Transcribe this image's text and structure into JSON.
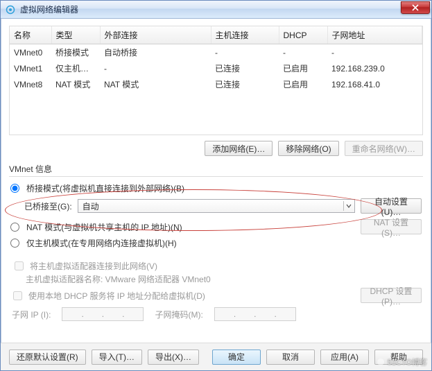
{
  "window": {
    "title": "虚拟网络编辑器",
    "close_icon": "close-icon"
  },
  "table": {
    "headers": {
      "name": "名称",
      "type": "类型",
      "external": "外部连接",
      "host": "主机连接",
      "dhcp": "DHCP",
      "subnet": "子网地址"
    },
    "rows": [
      {
        "name": "VMnet0",
        "type": "桥接模式",
        "external": "自动桥接",
        "host": "-",
        "dhcp": "-",
        "subnet": "-"
      },
      {
        "name": "VMnet1",
        "type": "仅主机…",
        "external": "-",
        "host": "已连接",
        "dhcp": "已启用",
        "subnet": "192.168.239.0"
      },
      {
        "name": "VMnet8",
        "type": "NAT 模式",
        "external": "NAT 模式",
        "host": "已连接",
        "dhcp": "已启用",
        "subnet": "192.168.41.0"
      }
    ]
  },
  "buttons": {
    "add_net": "添加网络(E)…",
    "remove_net": "移除网络(O)",
    "rename_net": "重命名网络(W)…",
    "auto_set": "自动设置(U)…",
    "nat_set": "NAT 设置(S)…",
    "dhcp_set": "DHCP 设置(P)…",
    "restore": "还原默认设置(R)",
    "import": "导入(T)…",
    "export": "导出(X)…",
    "ok": "确定",
    "cancel": "取消",
    "apply": "应用(A)",
    "help": "帮助"
  },
  "info": {
    "section_title": "VMnet 信息",
    "bridge_label": "桥接模式(将虚拟机直接连接到外部网络)(B)",
    "bridge_to_label": "已桥接至(G):",
    "bridge_to_value": "自动",
    "nat_label": "NAT 模式(与虚拟机共享主机的 IP 地址)(N)",
    "hostonly_label": "仅主机模式(在专用网络内连接虚拟机)(H)",
    "connect_host_label": "将主机虚拟适配器连接到此网络(V)",
    "adapter_name_label": "主机虚拟适配器名称: VMware 网络适配器 VMnet0",
    "use_dhcp_label": "使用本地 DHCP 服务将 IP 地址分配给虚拟机(D)",
    "subnet_ip_label": "子网 IP (I):",
    "subnet_mask_label": "子网掩码(M):"
  },
  "watermark": "51CTO博客"
}
